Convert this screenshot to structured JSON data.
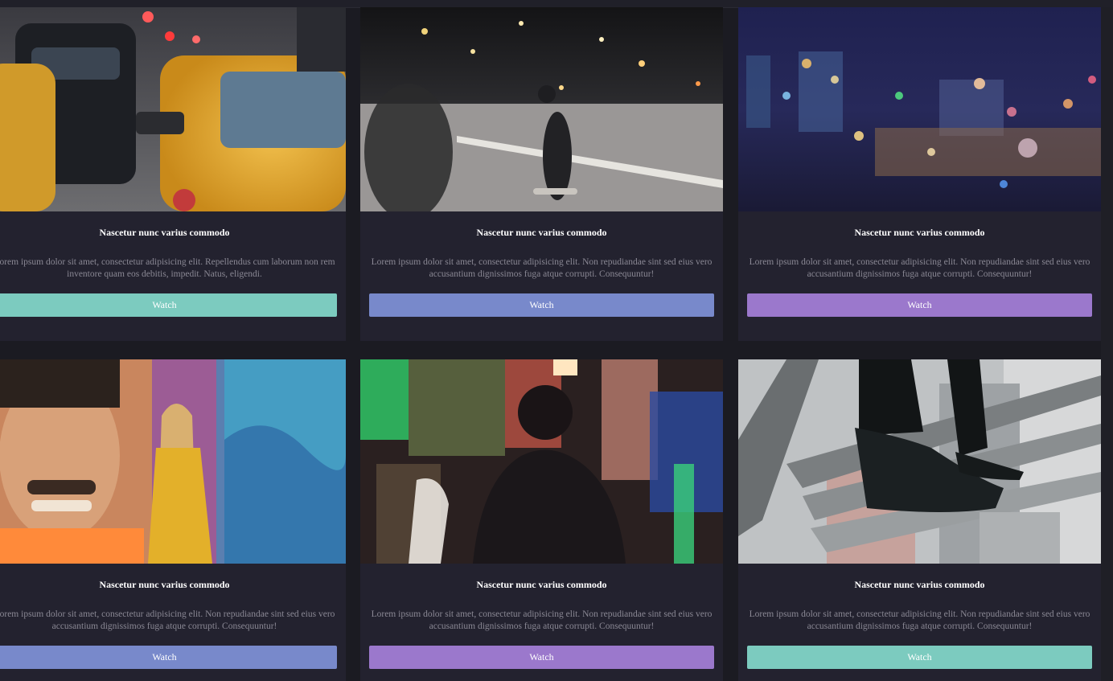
{
  "theme": {
    "background": "#1b1b22",
    "card_background": "#23222f",
    "title_color": "#ffffff",
    "text_color": "#8a8894",
    "accent_teal": "#7ccbbf",
    "accent_blue": "#7889cb",
    "accent_purple": "#9b78cc"
  },
  "cards": [
    {
      "image": "city-traffic-taxi-photo",
      "title": "Nascetur nunc varius commodo",
      "desc_line1": "Lorem ipsum dolor sit amet, consectetur adipisicing elit. Repellendus cum laborum non rem",
      "desc_line2": "inventore quam eos debitis, impedit. Natus, eligendi.",
      "button_label": "Watch",
      "button_color": "teal"
    },
    {
      "image": "skateboarder-night-street-photo",
      "title": "Nascetur nunc varius commodo",
      "desc_line1": "Lorem ipsum dolor sit amet, consectetur adipisicing elit. Non repudiandae sint sed eius vero",
      "desc_line2": "accusantium dignissimos fuga atque corrupti. Consequuntur!",
      "button_label": "Watch",
      "button_color": "blue"
    },
    {
      "image": "bokeh-city-lights-photo",
      "title": "Nascetur nunc varius commodo",
      "desc_line1": "Lorem ipsum dolor sit amet, consectetur adipisicing elit. Non repudiandae sint sed eius vero",
      "desc_line2": "accusantium dignissimos fuga atque corrupti. Consequuntur!",
      "button_label": "Watch",
      "button_color": "purple"
    },
    {
      "image": "woman-graffiti-wall-photo",
      "title": "Nascetur nunc varius commodo",
      "desc_line1": "Lorem ipsum dolor sit amet, consectetur adipisicing elit. Non repudiandae sint sed eius vero",
      "desc_line2": "accusantium dignissimos fuga atque corrupti. Consequuntur!",
      "button_label": "Watch",
      "button_color": "blue"
    },
    {
      "image": "man-neon-lights-photo",
      "title": "Nascetur nunc varius commodo",
      "desc_line1": "Lorem ipsum dolor sit amet, consectetur adipisicing elit. Non repudiandae sint sed eius vero",
      "desc_line2": "accusantium dignissimos fuga atque corrupti. Consequuntur!",
      "button_label": "Watch",
      "button_color": "purple"
    },
    {
      "image": "sneakers-stairs-photo",
      "title": "Nascetur nunc varius commodo",
      "desc_line1": "Lorem ipsum dolor sit amet, consectetur adipisicing elit. Non repudiandae sint sed eius vero",
      "desc_line2": "accusantium dignissimos fuga atque corrupti. Consequuntur!",
      "button_label": "Watch",
      "button_color": "teal"
    }
  ]
}
